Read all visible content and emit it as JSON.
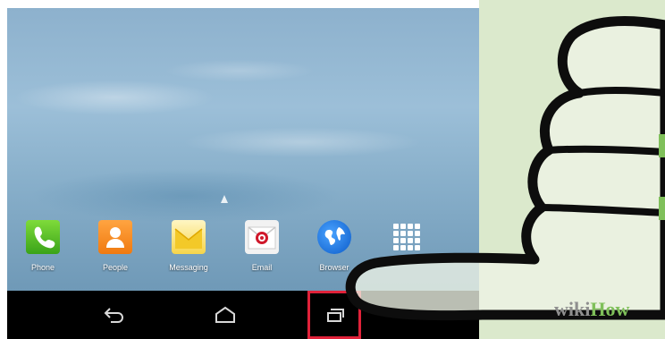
{
  "dock": {
    "apps": [
      {
        "label": "Phone"
      },
      {
        "label": "People"
      },
      {
        "label": "Messaging"
      },
      {
        "label": "Email"
      },
      {
        "label": "Browser"
      },
      {
        "label": ""
      }
    ]
  },
  "navbar": {
    "back_icon": "back-arrow-icon",
    "home_icon": "home-icon",
    "recent_icon": "recent-apps-icon",
    "highlight_color": "#e0223a"
  },
  "watermark": {
    "part1": "wiki",
    "part2": "How"
  },
  "colors": {
    "panel": "#dbe9cc",
    "accent": "#7fc05a"
  }
}
